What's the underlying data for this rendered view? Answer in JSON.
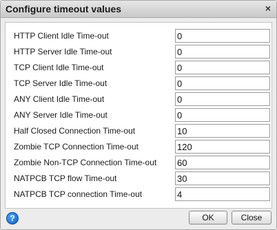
{
  "dialog": {
    "title": "Configure timeout values",
    "close_glyph": "×",
    "close_icon": "close-icon"
  },
  "fields": [
    {
      "label": "HTTP Client Idle Time-out",
      "value": "0"
    },
    {
      "label": "HTTP Server Idle Time-out",
      "value": "0"
    },
    {
      "label": "TCP Client Idle Time-out",
      "value": "0"
    },
    {
      "label": "TCP Server Idle Time-out",
      "value": "0"
    },
    {
      "label": "ANY Client Idle Time-out",
      "value": "0"
    },
    {
      "label": "ANY Server Idle Time-out",
      "value": "0"
    },
    {
      "label": "Half Closed Connection Time-out",
      "value": "10"
    },
    {
      "label": "Zombie TCP Connection Time-out",
      "value": "120"
    },
    {
      "label": "Zombie Non-TCP Connection Time-out",
      "value": "60"
    },
    {
      "label": "NATPCB TCP flow Time-out",
      "value": "30"
    },
    {
      "label": "NATPCB TCP connection Time-out",
      "value": "4"
    }
  ],
  "footer": {
    "help_glyph": "?",
    "help_icon": "help-icon",
    "ok_label": "OK",
    "close_label": "Close",
    "help_color": "#1a6fd0"
  }
}
